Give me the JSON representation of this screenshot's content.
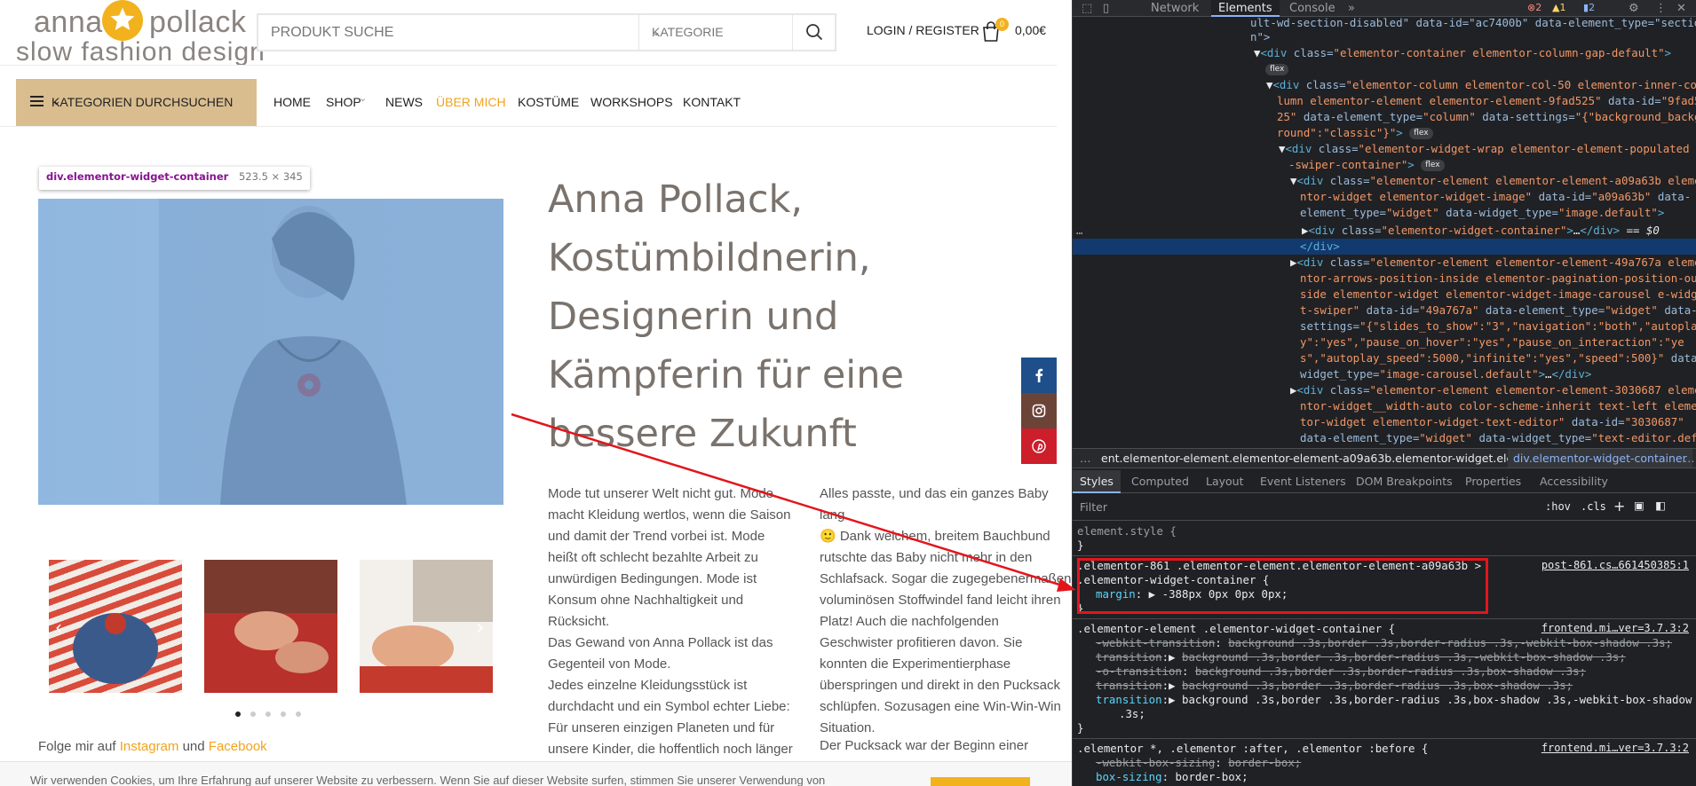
{
  "site": {
    "logo": {
      "line1_left": "anna",
      "line1_right": "pollack",
      "line2": "slow fashion design"
    },
    "search": {
      "placeholder": "PRODUKT SUCHE",
      "category_label": "KATEGORIE"
    },
    "login_label": "LOGIN / REGISTER",
    "cart": {
      "count": "0",
      "total": "0,00€"
    },
    "categories_button": "KATEGORIEN DURCHSUCHEN",
    "nav": [
      "HOME",
      "SHOP",
      "NEWS",
      "ÜBER MICH",
      "KOSTÜME",
      "WORKSHOPS",
      "KONTAKT"
    ],
    "nav_active": "ÜBER MICH",
    "inspect_tooltip": {
      "selector": "div.elementor-widget-container",
      "dims": "523.5 × 345"
    },
    "headline_lines": [
      "Anna Pollack,",
      "Kostümbildnerin,",
      "Designerin und",
      "Kämpferin für eine",
      "bessere Zukunft"
    ],
    "col1_text": "Mode tut unserer Welt nicht gut. Mode\nmacht Kleidung wertlos, wenn die Saison\nund damit der Trend vorbei ist. Mode\nheißt oft schlecht bezahlte Arbeit zu\nunwürdigen Bedingungen. Mode ist\nKonsum ohne Nachhaltigkeit und\nRücksicht.\nDas Gewand von Anna Pollack ist das\nGegenteil von Mode.\nJedes einzelne Kleidungsstück ist\ndurchdacht und ein Symbol echter Liebe:\nFür unseren einzigen Planeten und für\nunsere Kinder, die hoffentlich noch länger",
    "col2_text": "Alles passte, und das ein ganzes Baby lang\n🙂 Dank weichem, breitem Bauchbund\nrutschte das Baby nicht mehr in den\nSchlafsack. Sogar die zugegebenermaßen\nvoluminösen Stoffwindel fand leicht ihren\nPlatz! Auch die nachfolgenden\nGeschwister profitieren davon. Sie\nkonnten die Experimentierphase\nüberspringen und direkt in den Pucksack\nschlüpfen. Sozusagen eine Win-Win-Win\nSituation.",
    "col2_text_b": "Der Pucksack war der Beginn einer",
    "follow": {
      "prefix": "Folge mir auf ",
      "instagram": "Instagram",
      "und": " und ",
      "facebook": "Facebook"
    },
    "cookie_text": "Wir verwenden Cookies, um Ihre Erfahrung auf unserer Website zu verbessern. Wenn Sie auf dieser Website surfen, stimmen Sie unserer Verwendung von",
    "colors": {
      "accent": "#f2b21e",
      "catbar": "#d9bd8f",
      "facebook": "#1e4f8a",
      "instagram": "#6b4437",
      "pinterest": "#cc1f2b"
    }
  },
  "devtools": {
    "tabs": [
      "Network",
      "Elements",
      "Console"
    ],
    "active_tab": "Elements",
    "badges": {
      "errors": "2",
      "warnings": "1",
      "messages": "2"
    },
    "breadcrumb": [
      "ent.elementor-element.elementor-element-a09a63b.elementor-widget.elementor-widget-image",
      "div.elementor-widget-container"
    ],
    "sub_tabs": [
      "Styles",
      "Computed",
      "Layout",
      "Event Listeners",
      "DOM Breakpoints",
      "Properties",
      "Accessibility"
    ],
    "filter_placeholder": "Filter",
    "filter_tools": [
      ":hov",
      ".cls",
      "+"
    ],
    "element_style": "element.style {",
    "rule1": {
      "selector1": ".elementor-861 .elementor-element.elementor-element-a09a63b >",
      "selector2": ".elementor-widget-container {",
      "prop": "margin",
      "value": "-388px 0px 0px 0px;",
      "source": "post-861.cs…661450385:1"
    },
    "rule2": {
      "selector": ".elementor-element .elementor-widget-container {",
      "source": "frontend.mi…ver=3.7.3:2",
      "lines": [
        {
          "p": "-webkit-transition",
          "v": "background .3s,border .3s,border-radius .3s,-webkit-box-shadow .3s;",
          "struck": true
        },
        {
          "p": "transition",
          "v": "background .3s,border .3s,border-radius .3s,-webkit-box-shadow .3s;",
          "struck": true
        },
        {
          "p": "-o-transition",
          "v": "background .3s,border .3s,border-radius .3s,box-shadow .3s;",
          "struck": true
        },
        {
          "p": "transition",
          "v": "background .3s,border .3s,border-radius .3s,box-shadow .3s;",
          "struck": true
        },
        {
          "p": "transition",
          "v": "background .3s,border .3s,border-radius .3s,box-shadow .3s,-webkit-box-shadow",
          "struck": false
        }
      ],
      "wrap": ".3s;"
    },
    "rule3": {
      "selector": ".elementor *, .elementor :after, .elementor :before {",
      "source": "frontend.mi…ver=3.7.3:2",
      "l1p": "-webkit-box-sizing",
      "l1v": "border-box;",
      "l2p": "box-sizing",
      "l2v": "border-box;"
    }
  }
}
